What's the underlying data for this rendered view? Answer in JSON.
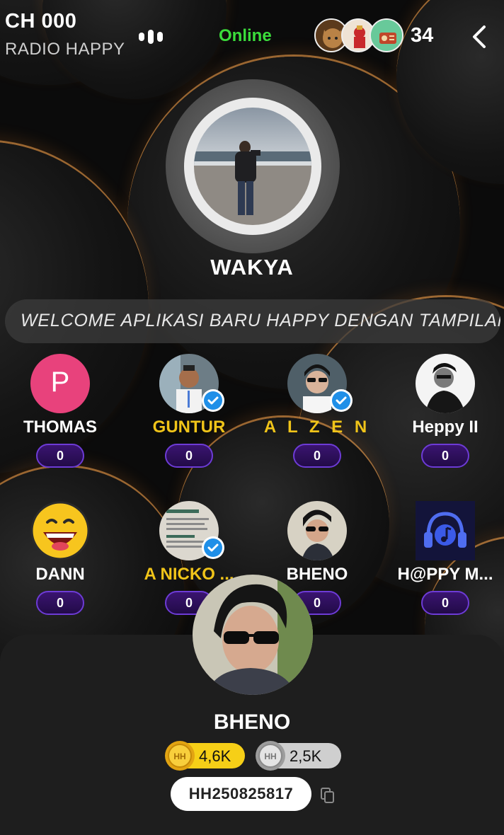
{
  "header": {
    "channel": "CH 000",
    "room_name": "RADIO HAPPY",
    "status": "Online",
    "status_color": "#3bdc3b",
    "viewer_count": "34",
    "icons": [
      "sound-wave-icon",
      "back-chevron-icon"
    ]
  },
  "host": {
    "name": "WAKYA"
  },
  "marquee": {
    "text": "WELCOME APLIKASI BARU HAPPY DENGAN TAMPILAN"
  },
  "seats": [
    {
      "name": "THOMAS",
      "count": "0",
      "initial": "P",
      "avatar_color": "#e8427c",
      "verified": false,
      "gold": false
    },
    {
      "name": "GUNTUR",
      "count": "0",
      "verified": true,
      "gold": true
    },
    {
      "name": "A L Z E N",
      "count": "0",
      "verified": true,
      "gold": true
    },
    {
      "name": "Heppy II",
      "count": "0",
      "verified": false,
      "gold": false
    },
    {
      "name": "DANN",
      "count": "0",
      "verified": false,
      "gold": false
    },
    {
      "name": "A  NICKO ...",
      "count": "0",
      "verified": true,
      "gold": true
    },
    {
      "name": "BHENO",
      "count": "0",
      "verified": false,
      "gold": false
    },
    {
      "name": "H@PPY M...",
      "count": "0",
      "verified": false,
      "gold": false
    }
  ],
  "profile": {
    "name": "BHENO",
    "gold_coins": "4,6K",
    "silver_coins": "2,5K",
    "user_id": "HH250825817",
    "gold_color": "#f6cf17",
    "silver_color": "#cfcfcf"
  },
  "accent_colors": {
    "seat_count_border": "#6d3bd6",
    "gold_name": "#f0c419",
    "verified_badge": "#1f8fe8"
  }
}
